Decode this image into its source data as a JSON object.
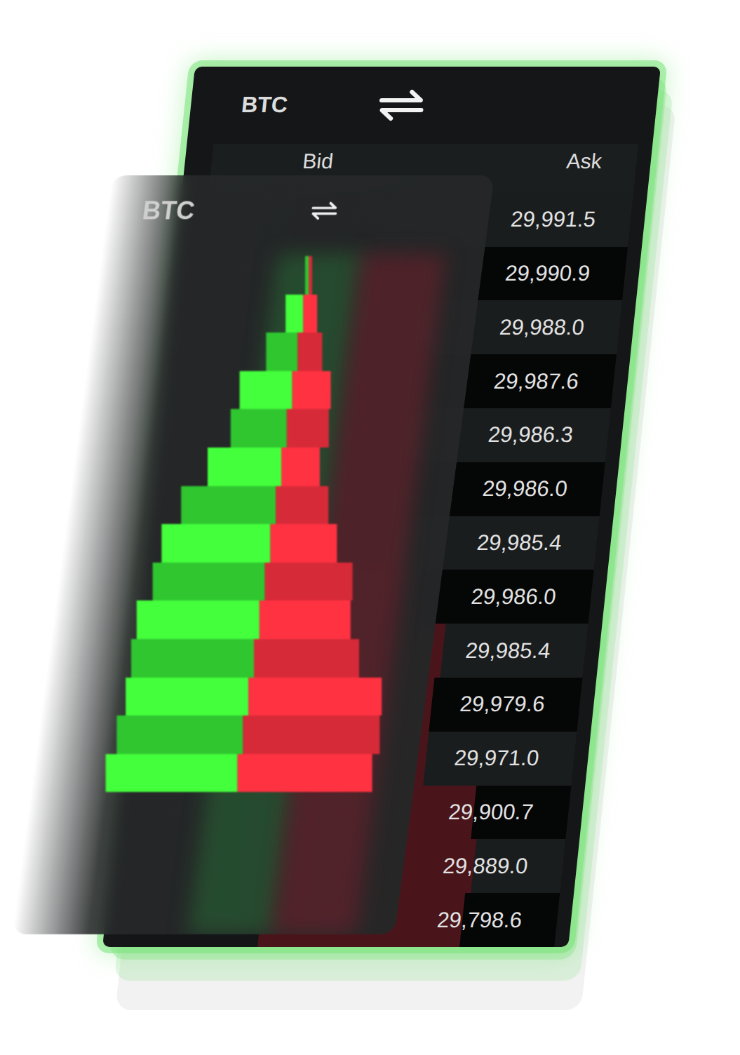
{
  "back_card": {
    "title": "BTC",
    "columns": [
      "Bid",
      "Ask"
    ],
    "asks": [
      {
        "price": "29,991.5",
        "level": 0
      },
      {
        "price": "29,990.9",
        "level": 0
      },
      {
        "price": "29,988.0",
        "level": 0
      },
      {
        "price": "29,987.6",
        "level": 0
      },
      {
        "price": "29,986.3",
        "level": 0
      },
      {
        "price": "29,986.0",
        "level": 0
      },
      {
        "price": "29,985.4",
        "level": 0
      },
      {
        "price": "29,986.0",
        "level": 0.42
      },
      {
        "price": "29,985.4",
        "level": 0.52
      },
      {
        "price": "29,979.6",
        "level": 0.5
      },
      {
        "price": "29,971.0",
        "level": 0.5
      },
      {
        "price": "29,900.7",
        "level": 0.68
      },
      {
        "price": "29,889.0",
        "level": 0.7
      },
      {
        "price": "29,798.6",
        "level": 0.68
      }
    ]
  },
  "front_card": {
    "title": "BTC",
    "depth_chart": {
      "bids": [
        0.5,
        2.5,
        4.5,
        7.5,
        8,
        10.5,
        13.5,
        15.5,
        16,
        17.5,
        17.5,
        17.5,
        18,
        18.8
      ],
      "asks": [
        0.5,
        2,
        3.5,
        5.5,
        6,
        5.5,
        7.5,
        9.5,
        12.5,
        13,
        15,
        19,
        19.5,
        19.2
      ]
    }
  }
}
